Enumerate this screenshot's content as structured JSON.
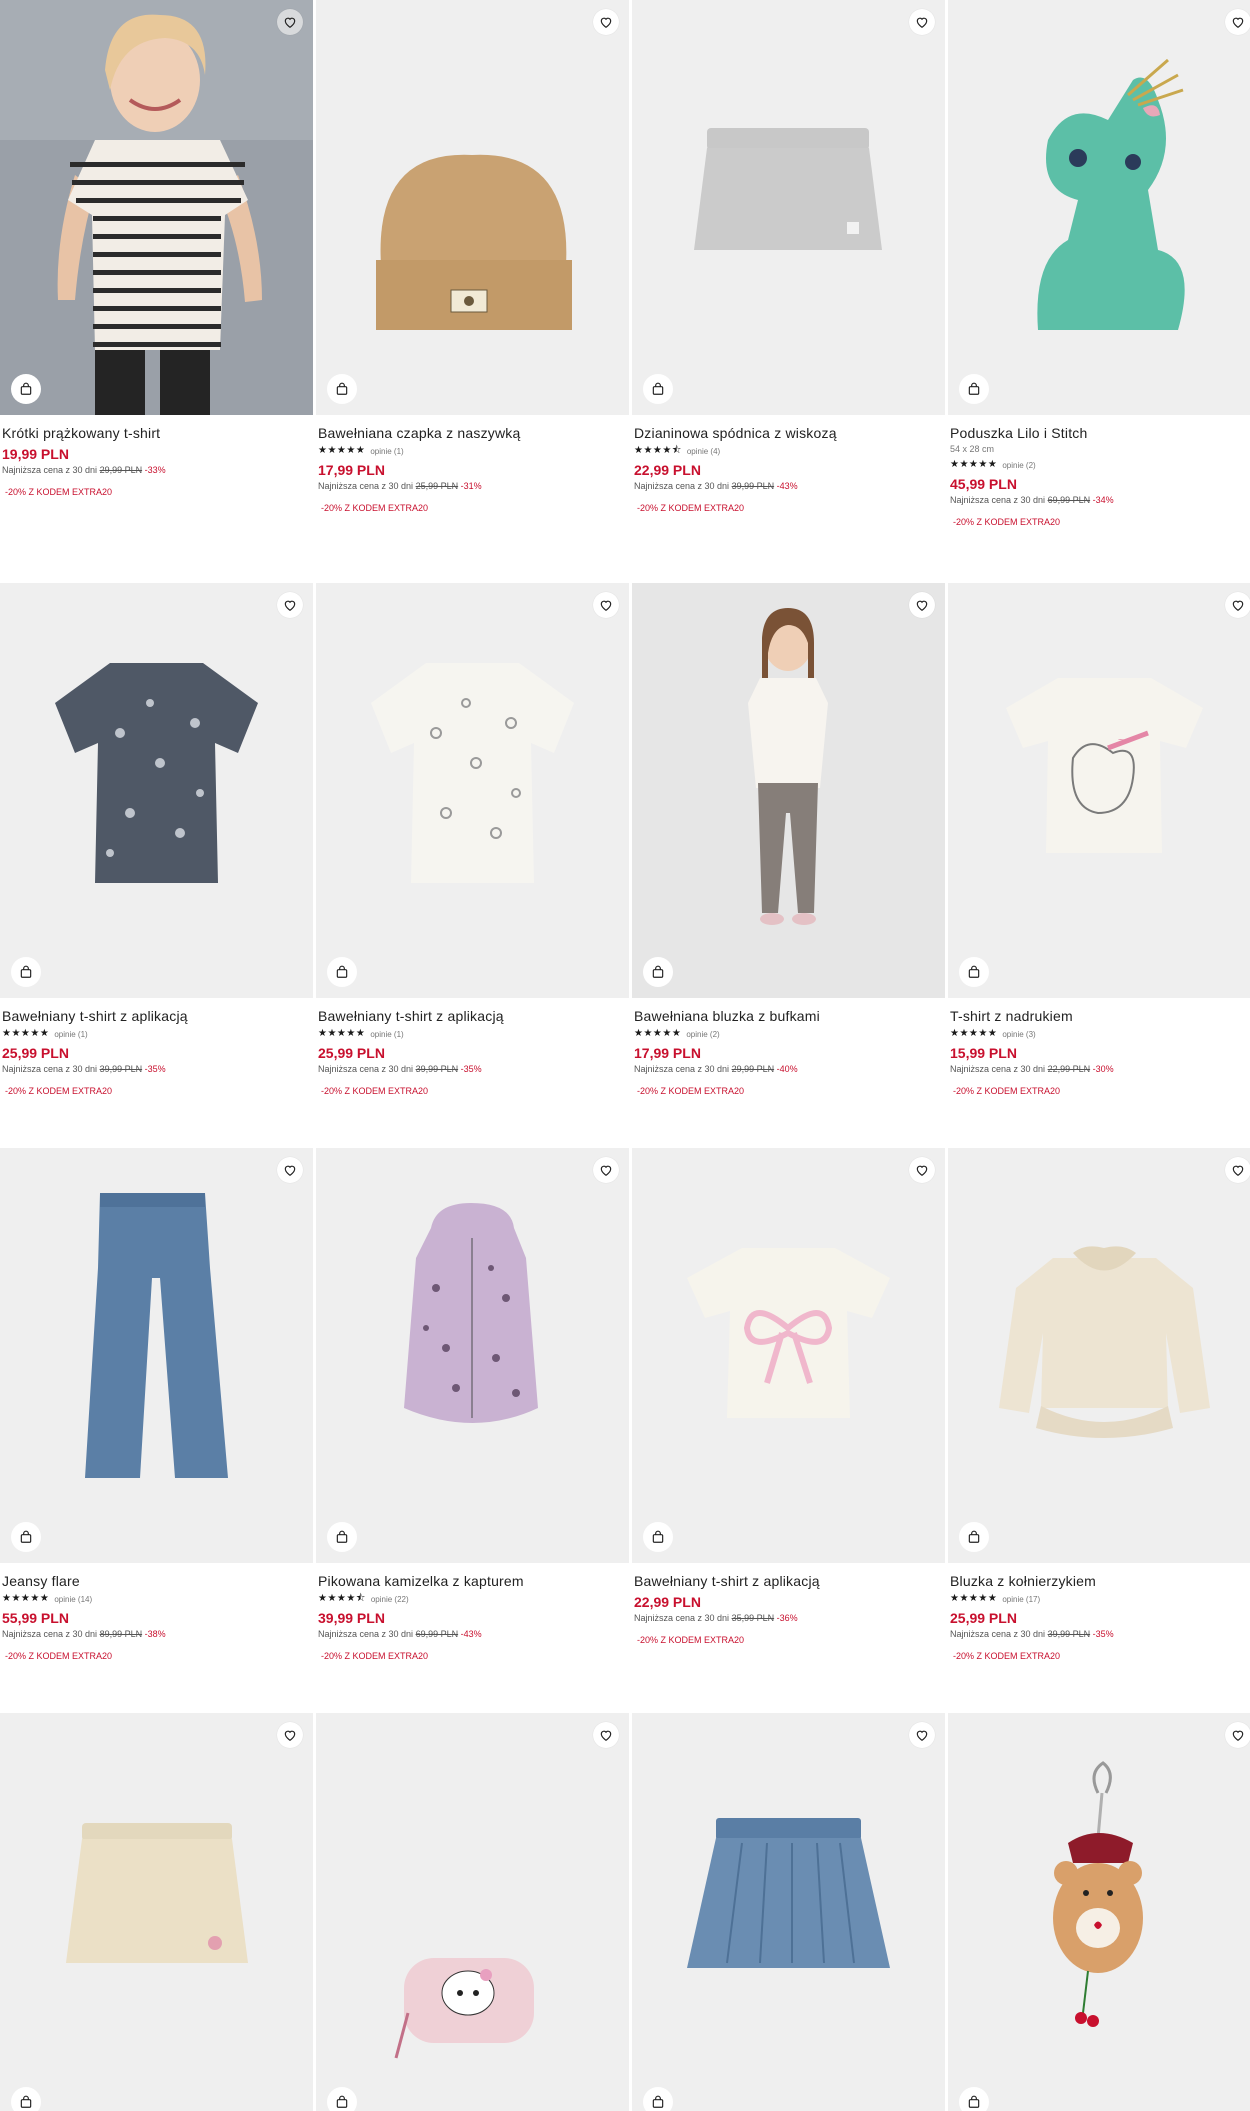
{
  "products": [
    {
      "name": "Krótki prążkowany t-shirt",
      "price": "19,99 PLN",
      "lowest_label": "Najniższa cena z 30 dni",
      "old_price": "29,99 PLN",
      "discount": "-33%",
      "promo": "-20% Z KODEM EXTRA20"
    },
    {
      "name": "Bawełniana czapka z naszywką",
      "stars": "★★★★★",
      "reviews": "opinie (1)",
      "price": "17,99 PLN",
      "lowest_label": "Najniższa cena z 30 dni",
      "old_price": "25,99 PLN",
      "discount": "-31%",
      "promo": "-20% Z KODEM EXTRA20"
    },
    {
      "name": "Dzianinowa spódnica z wiskozą",
      "stars": "★★★★⯪",
      "reviews": "opinie (4)",
      "price": "22,99 PLN",
      "lowest_label": "Najniższa cena z 30 dni",
      "old_price": "39,99 PLN",
      "discount": "-43%",
      "promo": "-20% Z KODEM EXTRA20"
    },
    {
      "name": "Poduszka Lilo i Stitch",
      "subtitle": "54 x 28 cm",
      "stars": "★★★★★",
      "reviews": "opinie (2)",
      "price": "45,99 PLN",
      "lowest_label": "Najniższa cena z 30 dni",
      "old_price": "69,99 PLN",
      "discount": "-34%",
      "promo": "-20% Z KODEM EXTRA20"
    },
    {
      "name": "Bawełniany t-shirt z aplikacją",
      "stars": "★★★★★",
      "reviews": "opinie (1)",
      "price": "25,99 PLN",
      "lowest_label": "Najniższa cena z 30 dni",
      "old_price": "39,99 PLN",
      "discount": "-35%",
      "promo": "-20% Z KODEM EXTRA20"
    },
    {
      "name": "Bawełniany t-shirt z aplikacją",
      "stars": "★★★★★",
      "reviews": "opinie (1)",
      "price": "25,99 PLN",
      "lowest_label": "Najniższa cena z 30 dni",
      "old_price": "39,99 PLN",
      "discount": "-35%",
      "promo": "-20% Z KODEM EXTRA20"
    },
    {
      "name": "Bawełniana bluzka z bufkami",
      "stars": "★★★★★",
      "reviews": "opinie (2)",
      "price": "17,99 PLN",
      "lowest_label": "Najniższa cena z 30 dni",
      "old_price": "29,99 PLN",
      "discount": "-40%",
      "promo": "-20% Z KODEM EXTRA20"
    },
    {
      "name": "T-shirt z nadrukiem",
      "stars": "★★★★★",
      "reviews": "opinie (3)",
      "price": "15,99 PLN",
      "lowest_label": "Najniższa cena z 30 dni",
      "old_price": "22,99 PLN",
      "discount": "-30%",
      "promo": "-20% Z KODEM EXTRA20"
    },
    {
      "name": "Jeansy flare",
      "stars": "★★★★★",
      "reviews": "opinie (14)",
      "price": "55,99 PLN",
      "lowest_label": "Najniższa cena z 30 dni",
      "old_price": "89,99 PLN",
      "discount": "-38%",
      "promo": "-20% Z KODEM EXTRA20"
    },
    {
      "name": "Pikowana kamizelka z kapturem",
      "stars": "★★★★⯪",
      "reviews": "opinie (22)",
      "price": "39,99 PLN",
      "lowest_label": "Najniższa cena z 30 dni",
      "old_price": "69,99 PLN",
      "discount": "-43%",
      "promo": "-20% Z KODEM EXTRA20"
    },
    {
      "name": "Bawełniany t-shirt z aplikacją",
      "price": "22,99 PLN",
      "lowest_label": "Najniższa cena z 30 dni",
      "old_price": "35,99 PLN",
      "discount": "-36%",
      "promo": "-20% Z KODEM EXTRA20"
    },
    {
      "name": "Bluzka z kołnierzykiem",
      "stars": "★★★★★",
      "reviews": "opinie (17)",
      "price": "25,99 PLN",
      "lowest_label": "Najniższa cena z 30 dni",
      "old_price": "39,99 PLN",
      "discount": "-35%",
      "promo": "-20% Z KODEM EXTRA20"
    },
    {
      "image": "skirt-beige"
    },
    {
      "image": "hello-kitty-pouch"
    },
    {
      "image": "denim-skirt"
    },
    {
      "image": "bear-keychain"
    }
  ],
  "icons": {
    "favorite": "heart-icon",
    "cart": "shopping-bag-icon"
  },
  "colors": {
    "price": "#c8102e",
    "image_bg": "#efefef"
  }
}
